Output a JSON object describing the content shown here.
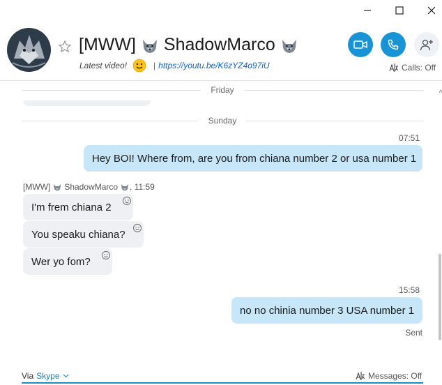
{
  "window": {
    "minimize_icon": "minimize-icon",
    "maximize_icon": "maximize-icon",
    "close_icon": "close-icon"
  },
  "header": {
    "title_prefix": "[MWW]",
    "title_name": "ShadowMarco",
    "mood_text": "Latest video!",
    "mood_link": "https://youtu.be/K6zYZ4o97iU",
    "separator": "|",
    "calls_status": "Calls: Off",
    "accent_color": "#1793d6"
  },
  "chat": {
    "day_separators": [
      "Friday",
      "Sunday"
    ],
    "messages_out_1": {
      "time": "07:51",
      "text": "Hey BOI! Where from, are you from chiana number 2 or usa number 1"
    },
    "incoming": {
      "sender_prefix": "[MWW]",
      "sender_name": "ShadowMarco",
      "sender_time": ", 11:59",
      "messages": [
        "I'm frem chiana 2",
        "You speaku chiana?",
        "Wer yo fom?"
      ]
    },
    "messages_out_2": {
      "time": "15:58",
      "text": "no no chinia number 3 USA number 1",
      "status": "Sent"
    }
  },
  "footer": {
    "via_label": "Via",
    "via_service": "Skype",
    "messages_status": "Messages: Off"
  }
}
